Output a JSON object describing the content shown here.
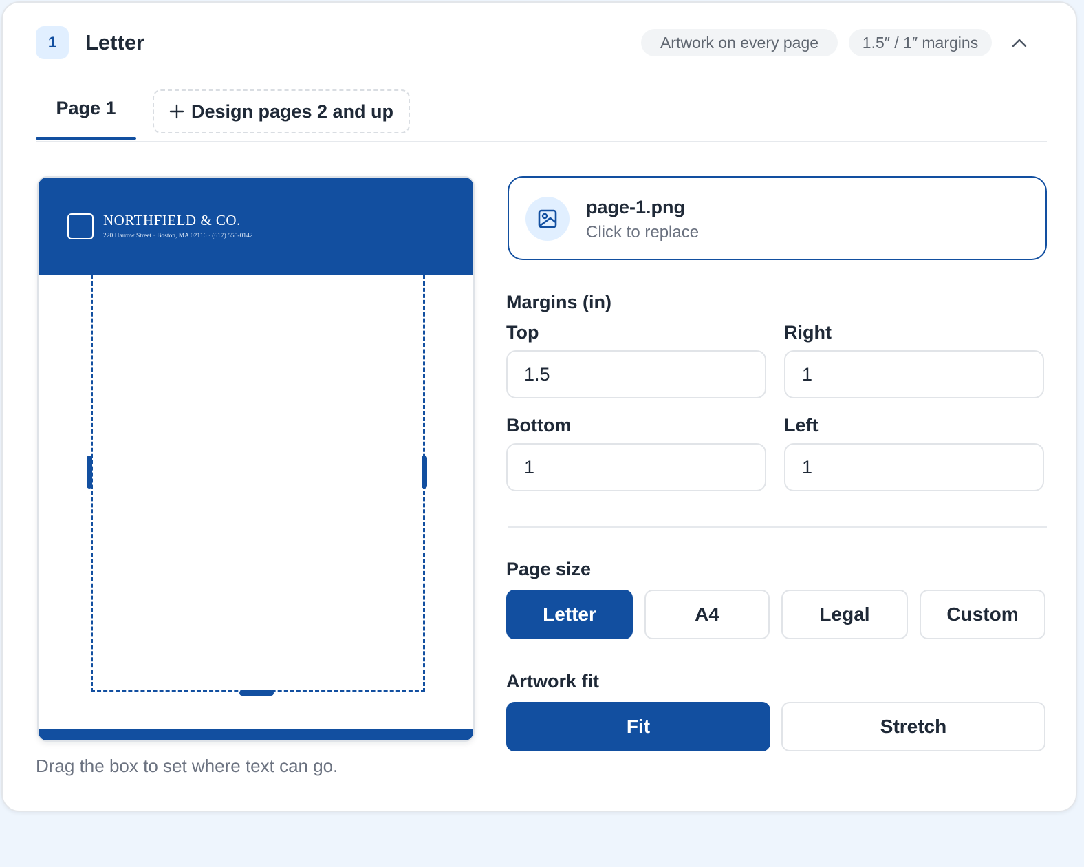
{
  "header": {
    "step_number": "1",
    "title": "Letter",
    "chips": {
      "artwork": "Artwork on every page",
      "margins": "1.5″ / 1″ margins"
    },
    "collapse_icon": "chevron-up-icon"
  },
  "tabs": {
    "page1_label": "Page 1",
    "add_label": "Design pages 2 and up",
    "add_icon": "plus-icon"
  },
  "preview": {
    "company_name": "NORTHFIELD & CO.",
    "company_address": "220 Harrow Street · Boston, MA 02116 · (617) 555-0142",
    "hint": "Drag the box to set where text can go."
  },
  "artwork_file": {
    "name": "page-1.png",
    "action": "Click to replace",
    "icon": "image-icon"
  },
  "margins": {
    "label": "Margins (in)",
    "top": {
      "label": "Top",
      "value": "1.5"
    },
    "right": {
      "label": "Right",
      "value": "1"
    },
    "bottom": {
      "label": "Bottom",
      "value": "1"
    },
    "left": {
      "label": "Left",
      "value": "1"
    }
  },
  "page_size": {
    "label": "Page size",
    "options": [
      "Letter",
      "A4",
      "Legal",
      "Custom"
    ],
    "selected": "Letter"
  },
  "artwork_fit": {
    "label": "Artwork fit",
    "options": [
      "Fit",
      "Stretch"
    ],
    "selected": "Fit"
  },
  "colors": {
    "accent": "#124fa0",
    "badge_bg": "#e1efff",
    "page_bg": "#eef5fd"
  }
}
